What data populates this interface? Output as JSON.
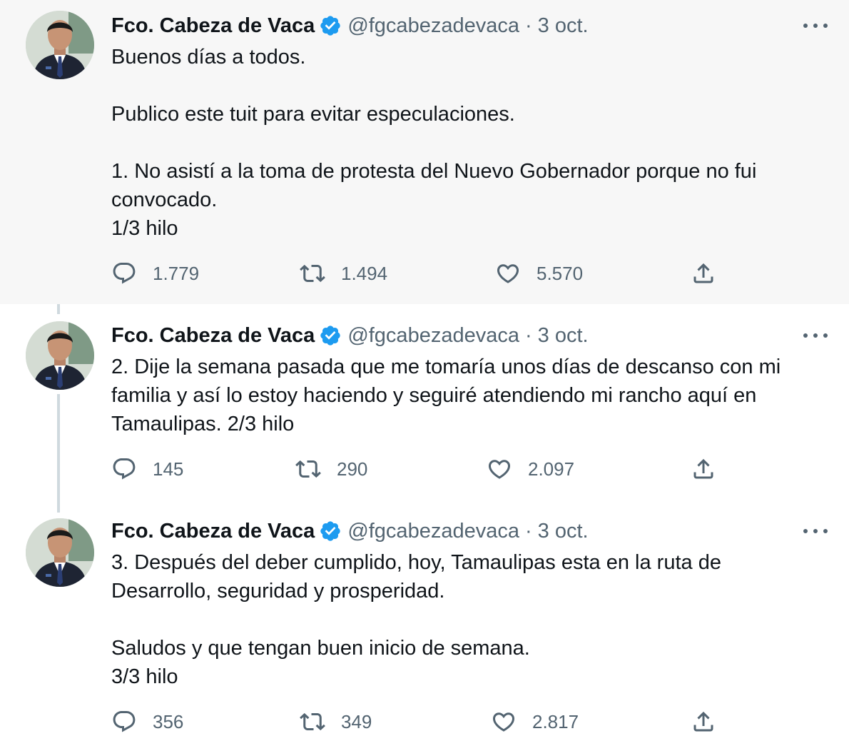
{
  "author": {
    "name": "Fco. Cabeza de Vaca",
    "handle": "@fgcabezadevaca",
    "separator": "·",
    "date": "3 oct."
  },
  "colors": {
    "verified": "#1d9bf0",
    "icon": "#536471",
    "thread_line": "#cfd9de",
    "highlight_bg": "#f7f7f7"
  },
  "icons": {
    "verified": "verified-badge-icon",
    "more": "more-options-icon",
    "reply": "reply-icon",
    "retweet": "retweet-icon",
    "like": "heart-icon",
    "share": "share-icon"
  },
  "tweets": [
    {
      "lines": [
        "Buenos días a todos.",
        "",
        "Publico este tuit para evitar especulaciones.",
        "",
        "1. No asistí a la toma de protesta del Nuevo Gobernador porque no fui",
        "convocado.",
        "1/3 hilo"
      ],
      "replies": "1.779",
      "retweets": "1.494",
      "likes": "5.570"
    },
    {
      "lines": [
        "2. Dije la semana pasada que me tomaría unos días de descanso con mi",
        "familia y así lo estoy haciendo y seguiré atendiendo mi rancho aquí en",
        "Tamaulipas. 2/3 hilo"
      ],
      "replies": "145",
      "retweets": "290",
      "likes": "2.097"
    },
    {
      "lines": [
        "3. Después del deber cumplido, hoy, Tamaulipas esta en la ruta de",
        "Desarrollo, seguridad y prosperidad.",
        "",
        "Saludos y que tengan buen inicio de semana.",
        "3/3 hilo"
      ],
      "replies": "356",
      "retweets": "349",
      "likes": "2.817"
    }
  ]
}
